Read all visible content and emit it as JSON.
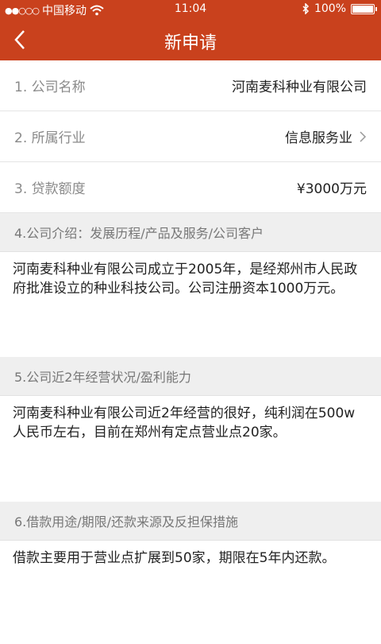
{
  "status_bar": {
    "signal": "●●○○○",
    "carrier": "中国移动",
    "time": "11:04",
    "battery_pct": "100%"
  },
  "nav": {
    "title": "新申请"
  },
  "rows": [
    {
      "label": "1. 公司名称",
      "value": "河南麦科种业有限公司"
    },
    {
      "label": "2. 所属行业",
      "value": "信息服务业"
    },
    {
      "label": "3. 贷款额度",
      "value": "¥3000万元"
    }
  ],
  "sections": [
    {
      "header": "4.公司介绍：发展历程/产品及服务/公司客户",
      "body": "河南麦科种业有限公司成立于2005年，是经郑州市人民政府批准设立的种业科技公司。公司注册资本1000万元。"
    },
    {
      "header": "5.公司近2年经营状况/盈利能力",
      "body": "河南麦科种业有限公司近2年经营的很好，纯利润在500w人民币左右，目前在郑州有定点营业点20家。"
    },
    {
      "header": "6.借款用途/期限/还款来源及反担保措施",
      "body": "借款主要用于营业点扩展到50家，期限在5年内还款。"
    }
  ],
  "colors": {
    "brand": "#c9411d"
  }
}
